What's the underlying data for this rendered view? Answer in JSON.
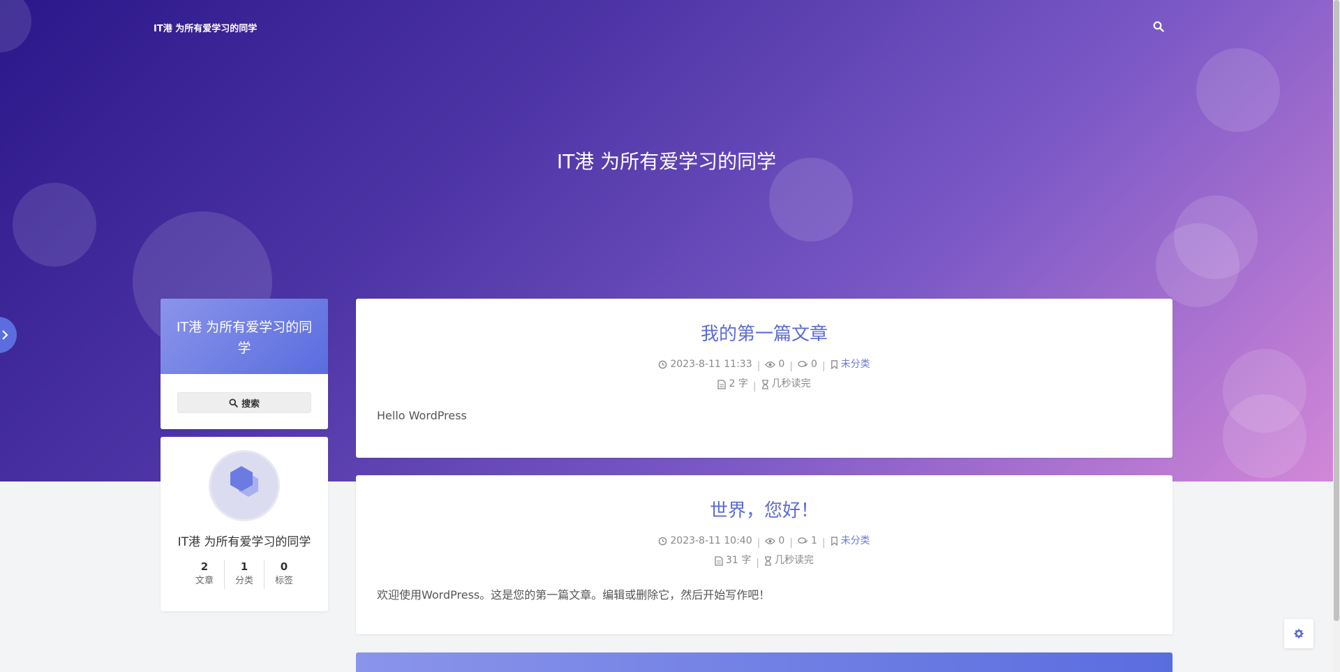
{
  "header": {
    "brand": "IT港 为所有爱学习的同学",
    "hero_title": "IT港 为所有爱学习的同学"
  },
  "sidebar": {
    "site_card_title": "IT港 为所有爱学习的同学",
    "search_label": "搜索",
    "author": {
      "name": "IT港 为所有爱学习的同学",
      "stats": [
        {
          "value": "2",
          "label": "文章"
        },
        {
          "value": "1",
          "label": "分类"
        },
        {
          "value": "0",
          "label": "标签"
        }
      ]
    }
  },
  "posts": [
    {
      "title": "我的第一篇文章",
      "date": "2023-8-11 11:33",
      "views": "0",
      "comments": "0",
      "category": "未分类",
      "words": "2 字",
      "read_time": "几秒读完",
      "excerpt": "Hello WordPress"
    },
    {
      "title": "世界，您好！",
      "date": "2023-8-11 10:40",
      "views": "0",
      "comments": "1",
      "category": "未分类",
      "words": "31 字",
      "read_time": "几秒读完",
      "excerpt": "欢迎使用WordPress。这是您的第一篇文章。编辑或删除它，然后开始写作吧！"
    }
  ],
  "colors": {
    "accent": "#5b6bd6",
    "hero_start": "#2b178a",
    "hero_end": "#d388d8"
  }
}
